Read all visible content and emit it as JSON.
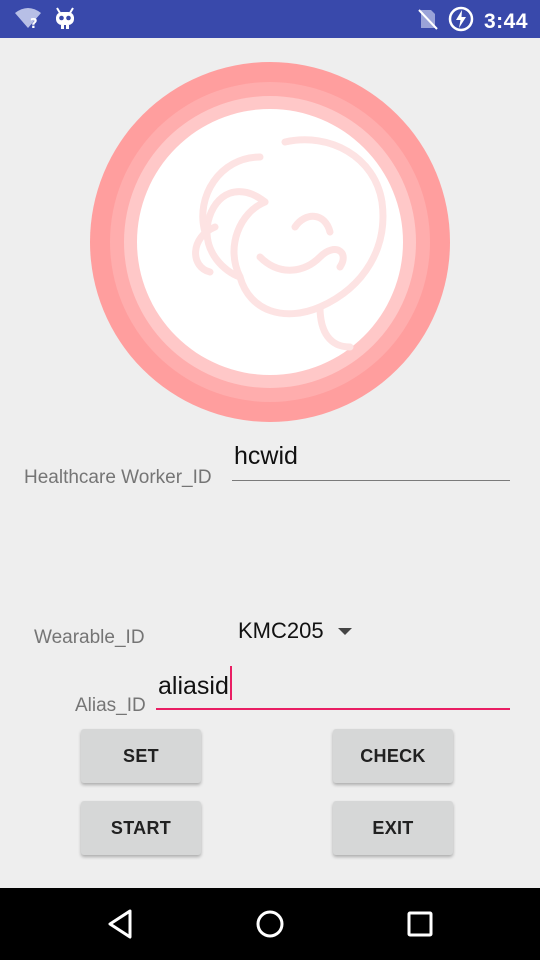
{
  "status_bar": {
    "time": "3:44",
    "icons": [
      "wifi-unknown-icon",
      "debug-icon",
      "no-sim-icon",
      "battery-charging-icon"
    ]
  },
  "form": {
    "healthcare_worker_label": "Healthcare Worker_ID",
    "healthcare_worker_value": "hcwid",
    "wearable_label": "Wearable_ID",
    "wearable_selected": "KMC205",
    "alias_label": "Alias_ID",
    "alias_value": "aliasid"
  },
  "buttons": {
    "set": "SET",
    "check": "CHECK",
    "start": "START",
    "exit": "EXIT"
  },
  "nav_bar": {
    "icons": [
      "back-icon",
      "home-icon",
      "recents-icon"
    ]
  },
  "colors": {
    "status_bar": "#3949ab",
    "accent": "#e91e63",
    "logo_ring": "#ff9a9a"
  }
}
